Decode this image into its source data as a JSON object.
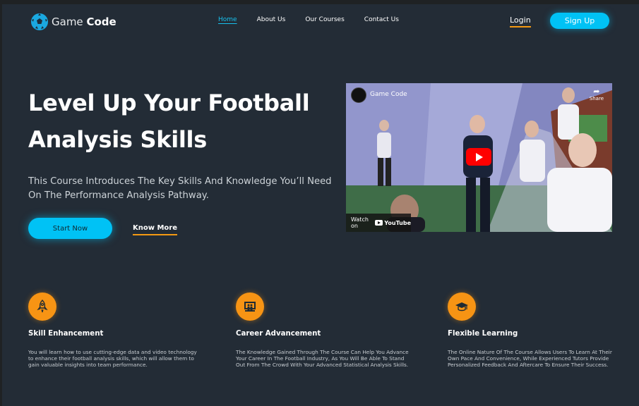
{
  "nav": {
    "brand_light": "Game",
    "brand_bold": "Code",
    "links": [
      "Home",
      "About Us",
      "Our Courses",
      "Contact Us"
    ],
    "login": "Login",
    "signup": "Sign Up"
  },
  "hero": {
    "title_line1": "Level Up Your Football",
    "title_line2": "Analysis Skills",
    "subtitle": "This Course Introduces The Key Skills And Knowledge You’ll Need On The Performance Analysis Pathway.",
    "start_button": "Start Now",
    "know_more": "Know More"
  },
  "video": {
    "channel_title": "Game Code",
    "share_label": "Share",
    "watch_on": "Watch on",
    "youtube_label": "YouTube"
  },
  "features": [
    {
      "icon": "rocket-icon",
      "title": "Skill Enhancement",
      "description": "You will learn how to use cutting-edge data and video technology to enhance their football analysis skills, which will allow them to gain valuable insights into team performance."
    },
    {
      "icon": "presentation-icon",
      "title": "Career Advancement",
      "description": "The Knowledge Gained Through The Course Can Help You Advance Your Career In The Football Industry, As You Will Be Able To Stand Out From The Crowd With Your Advanced Statistical Analysis Skills."
    },
    {
      "icon": "graduation-cap-icon",
      "title": "Flexible Learning",
      "description": "The Online Nature Of The Course Allows Users To Learn At Their Own Pace And Convenience, While Experienced Tutors Provide Personalized Feedback And Aftercare To Ensure Their Success."
    }
  ],
  "colors": {
    "background": "#232c36",
    "accent_cyan": "#00c2f5",
    "accent_orange": "#f79414"
  }
}
